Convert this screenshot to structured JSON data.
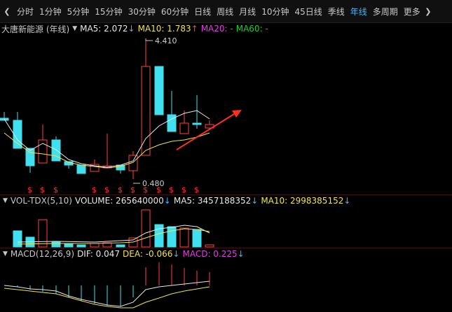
{
  "toolbar": {
    "left_arrow": "❮",
    "right_arrow": "❯",
    "periods": [
      "分时",
      "1分钟",
      "5分钟",
      "15分钟",
      "30分钟",
      "60分钟",
      "日线",
      "周线",
      "月线",
      "10分钟",
      "45日线",
      "季线",
      "年线",
      "多周期",
      "更多"
    ],
    "active": "年线"
  },
  "main": {
    "title": "大唐新能源 (年线)",
    "ma5_label": "MA5: 2.072",
    "ma10_label": "MA10: 1.783",
    "ma20_label": "MA20: -",
    "ma60_label": "MA60: -",
    "high_label": "4.410",
    "low_label": "0.480",
    "marker_glyph": "$"
  },
  "volume": {
    "title": "VOL-TDX(5,10)",
    "volume_label": "VOLUME: 265640000",
    "ma5_label": "MA5: 3457188352",
    "ma10_label": "MA10: 2998385152"
  },
  "macd": {
    "title": "MACD(12,26,9)",
    "dif_label": "DIF: 0.047",
    "dea_label": "DEA: -0.066",
    "macd_label": "MACD: 0.225"
  },
  "colors": {
    "up": "#ff4040",
    "down": "#40e0f0",
    "ma5": "#e8e8e8",
    "ma10": "#f2e34a",
    "annotation_arrow": "#ff3020",
    "active_tab": "#3cb6ff"
  },
  "icons": {
    "header_dropdown": "chevron-down-icon",
    "toolbar_nav": "chevron-left-icon"
  }
}
